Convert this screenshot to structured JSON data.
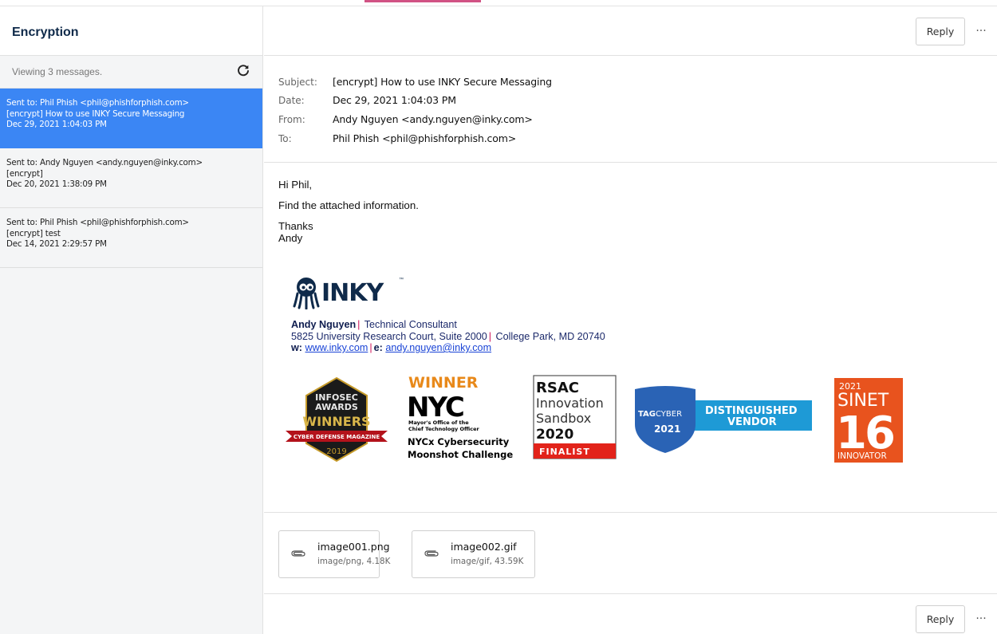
{
  "sidebar": {
    "title": "Encryption",
    "status": "Viewing 3 messages.",
    "messages": [
      {
        "to": "Sent to: Phil Phish <phil@phishforphish.com>",
        "subject": "[encrypt] How to use INKY Secure Messaging",
        "date": "Dec 29, 2021 1:04:03 PM"
      },
      {
        "to": "Sent to: Andy Nguyen <andy.nguyen@inky.com>",
        "subject": "[encrypt]",
        "date": "Dec 20, 2021 1:38:09 PM"
      },
      {
        "to": "Sent to: Phil Phish <phil@phishforphish.com>",
        "subject": "[encrypt] test",
        "date": "Dec 14, 2021 2:29:57 PM"
      }
    ]
  },
  "toolbar": {
    "reply_label": "Reply",
    "more_label": "···"
  },
  "headers": {
    "subject_label": "Subject:",
    "subject": "[encrypt] How to use INKY Secure Messaging",
    "date_label": "Date:",
    "date": "Dec 29, 2021 1:04:03 PM",
    "from_label": "From:",
    "from": "Andy Nguyen <andy.nguyen@inky.com>",
    "to_label": "To:",
    "to": "Phil Phish <phil@phishforphish.com>"
  },
  "body": {
    "greeting": "Hi Phil,",
    "line1": "Find the attached information.",
    "closing1": "Thanks",
    "closing2": "Andy"
  },
  "signature": {
    "logo": "INKY",
    "logo_tm": "™",
    "name": "Andy Nguyen",
    "title": " Technical Consultant",
    "address": "5825 University Research Court, Suite 2000",
    "city": " College Park, MD 20740",
    "web_label": "w:",
    "web": "www.inky.com",
    "email_label": "e:",
    "email": "andy.nguyen@inky.com",
    "sep": "|"
  },
  "badges": {
    "infosec": {
      "line1": "INFOSEC",
      "line2": "AWARDS",
      "line3": "WINNERS",
      "line4": "CYBER DEFENSE MAGAZINE",
      "year": "2019"
    },
    "nyc": {
      "winner": "WINNER",
      "nyc": "NYC",
      "office1": "Mayor's Office of the",
      "office2": "Chief Technology Officer",
      "line1": "NYCx Cybersecurity",
      "line2": "Moonshot Challenge"
    },
    "rsac": {
      "brand": "RSAC",
      "line1": "Innovation",
      "line2": "Sandbox",
      "year": "2020",
      "finalist": "FINALIST"
    },
    "tagcyber": {
      "brand_a": "TAG",
      "brand_b": "CYBER",
      "year": "2021",
      "line1": "DISTINGUISHED",
      "line2": "VENDOR"
    },
    "sinet": {
      "year": "2021",
      "brand": "SINET",
      "num": "16",
      "label": "INNOVATOR"
    }
  },
  "attachments": [
    {
      "name": "image001.png",
      "meta": "image/png, 4.18K"
    },
    {
      "name": "image002.gif",
      "meta": "image/gif, 43.59K"
    }
  ],
  "colors": {
    "accent": "#3b86f4",
    "brand_navy": "#0f2a4a",
    "link": "#1a44d6",
    "separator": "#d0135a"
  }
}
